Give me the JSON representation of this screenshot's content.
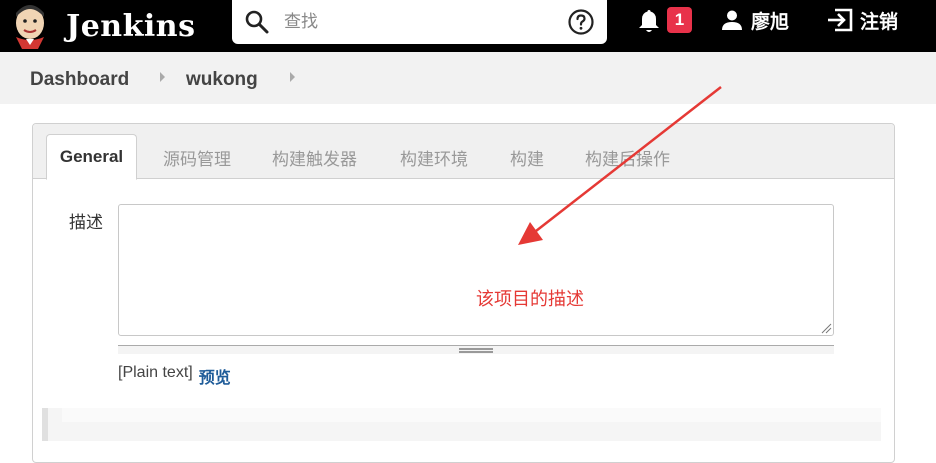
{
  "header": {
    "app_name": "Jenkins",
    "search_placeholder": "查找",
    "notification_count": "1",
    "user_name": "廖旭",
    "logout_label": "注销"
  },
  "breadcrumb": {
    "items": [
      "Dashboard",
      "wukong"
    ]
  },
  "tabs": [
    {
      "label": "General",
      "active": true
    },
    {
      "label": "源码管理"
    },
    {
      "label": "构建触发器"
    },
    {
      "label": "构建环境"
    },
    {
      "label": "构建"
    },
    {
      "label": "构建后操作"
    }
  ],
  "form": {
    "description_label": "描述",
    "description_value": "",
    "markup_format": "[Plain text]",
    "preview_label": "预览"
  },
  "annotation": {
    "text": "该项目的描述",
    "color": "#e53935"
  },
  "colors": {
    "topbar": "#000000",
    "badge": "#e8324a",
    "link": "#1f5c99"
  }
}
